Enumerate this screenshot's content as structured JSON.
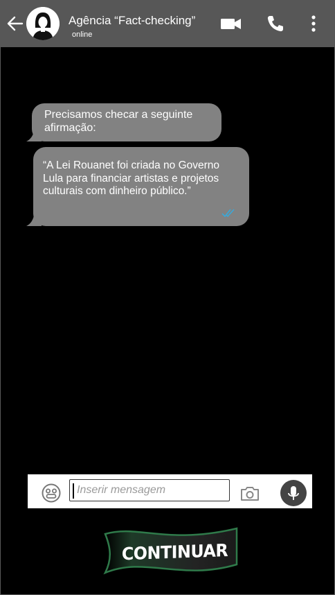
{
  "header": {
    "contact_name": "Agência “Fact-checking”",
    "status": "online",
    "icons": {
      "back": "arrow-left-icon",
      "avatar": "user-avatar-icon",
      "video": "video-camera-icon",
      "call": "phone-icon",
      "menu": "more-vertical-icon"
    }
  },
  "messages": [
    {
      "text": "Precisamos checar a seguinte afirmação:"
    },
    {
      "text": "“A Lei Rouanet foi criada no Governo Lula para financiar artistas e projetos culturais com dinheiro público.”",
      "status_icon": "double-check-icon"
    }
  ],
  "composer": {
    "placeholder": "Inserir mensagem",
    "value": "",
    "icons": {
      "emoji": "emoji-icon",
      "camera": "camera-icon",
      "mic": "microphone-icon"
    }
  },
  "continue_button": {
    "label": "CONTINUAR"
  },
  "colors": {
    "header_bg": "#575757",
    "bubble_bg": "#828282",
    "read_ticks": "#3aa8d8",
    "banner_green": "#2f7a4a"
  }
}
